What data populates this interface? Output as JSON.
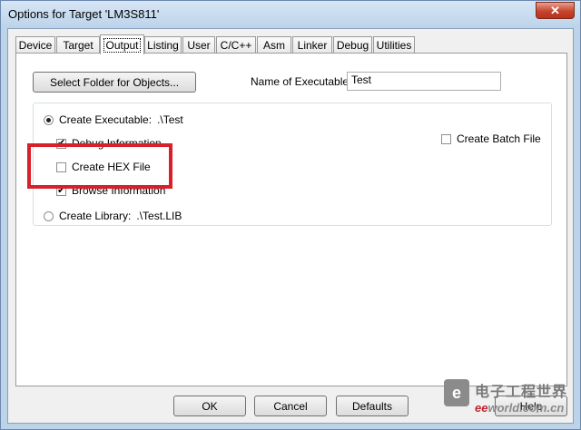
{
  "window": {
    "title": "Options for Target 'LM3S811'",
    "close_glyph": "✕"
  },
  "tabs": [
    {
      "label": "Device"
    },
    {
      "label": "Target"
    },
    {
      "label": "Output"
    },
    {
      "label": "Listing"
    },
    {
      "label": "User"
    },
    {
      "label": "C/C++"
    },
    {
      "label": "Asm"
    },
    {
      "label": "Linker"
    },
    {
      "label": "Debug"
    },
    {
      "label": "Utilities"
    }
  ],
  "active_tab": "Output",
  "output": {
    "select_folder_label": "Select Folder for Objects...",
    "name_label": "Name of Executable:",
    "name_value": "Test",
    "create_executable_label": "Create Executable:",
    "create_executable_path": ".\\Test",
    "create_executable_selected": true,
    "debug_info_label": "Debug Information",
    "debug_info_checked": true,
    "create_hex_label": "Create HEX File",
    "create_hex_checked": false,
    "browse_info_label": "Browse Information",
    "browse_info_checked": true,
    "create_batch_label": "Create Batch File",
    "create_batch_checked": false,
    "create_library_label": "Create Library:",
    "create_library_path": ".\\Test.LIB",
    "create_library_selected": false
  },
  "footer": {
    "ok": "OK",
    "cancel": "Cancel",
    "defaults": "Defaults",
    "help": "Help"
  },
  "watermark": {
    "cn": "电子工程世界",
    "en_accent": "ee",
    "en_rest": "world.com.cn",
    "mark": "e"
  },
  "colors": {
    "highlight": "#d8202b",
    "title_bg": "#bcd3ea"
  }
}
